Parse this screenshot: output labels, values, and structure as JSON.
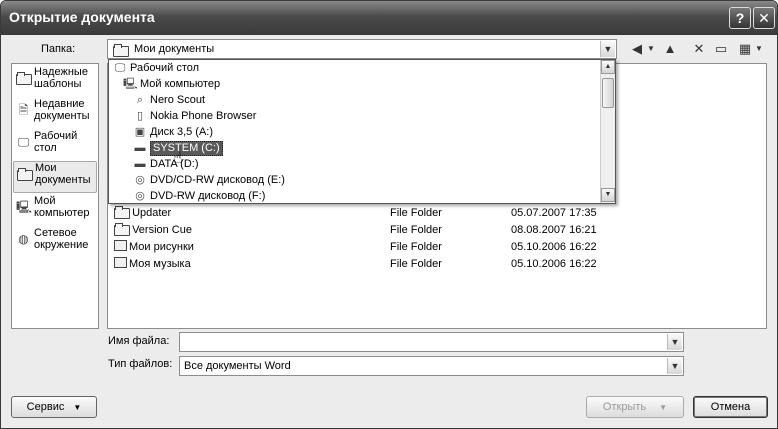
{
  "window": {
    "title": "Открытие документа"
  },
  "titlebar": {
    "help": "?",
    "close": "✕"
  },
  "look_in": {
    "label": "Папка:",
    "value": "Мои документы"
  },
  "toolbar": {
    "back": "◀",
    "up": "▲",
    "delete": "✕",
    "new_folder": "▭",
    "views": "▦"
  },
  "places": [
    {
      "label": "Надежные шаблоны",
      "icon": "folder-icon"
    },
    {
      "label": "Недавние документы",
      "icon": "recent-documents-icon"
    },
    {
      "label": "Рабочий стол",
      "icon": "desktop-icon"
    },
    {
      "label": "Мои документы",
      "icon": "my-documents-icon",
      "selected": true
    },
    {
      "label": "Мой компьютер",
      "icon": "computer-icon"
    },
    {
      "label": "Сетевое окружение",
      "icon": "network-icon"
    }
  ],
  "dropdown_items": [
    {
      "label": "Рабочий стол",
      "icon": "desktop-icon"
    },
    {
      "label": "Мой компьютер",
      "icon": "computer-icon"
    },
    {
      "label": "Nero Scout",
      "icon": "search-icon"
    },
    {
      "label": "Nokia Phone Browser",
      "icon": "phone-icon"
    },
    {
      "label": "Диск 3,5 (A:)",
      "icon": "floppy-icon"
    },
    {
      "label": "SYSTEM (C:)",
      "icon": "hard-drive-icon",
      "selected": true
    },
    {
      "label": "DATA (D:)",
      "icon": "hard-drive-icon"
    },
    {
      "label": "DVD/CD-RW дисковод (E:)",
      "icon": "optical-drive-icon"
    },
    {
      "label": "DVD-RW дисковод (F:)",
      "icon": "optical-drive-icon"
    }
  ],
  "files": [
    {
      "name": "Updater",
      "type": "File Folder",
      "date": "05.07.2007 17:35",
      "icon": "folder-icon"
    },
    {
      "name": "Version Cue",
      "type": "File Folder",
      "date": "08.08.2007 16:21",
      "icon": "folder-icon"
    },
    {
      "name": "Мои рисунки",
      "type": "File Folder",
      "date": "05.10.2006 16:22",
      "icon": "pictures-folder-icon"
    },
    {
      "name": "Моя музыка",
      "type": "File Folder",
      "date": "05.10.2006 16:22",
      "icon": "music-folder-icon"
    }
  ],
  "filename": {
    "label": "Имя файла:",
    "value": ""
  },
  "filetype": {
    "label": "Тип файлов:",
    "value": "Все документы Word"
  },
  "buttons": {
    "service": "Сервис",
    "open": "Открыть",
    "cancel": "Отмена"
  },
  "glyphs": {
    "dropdown_arrow": "▼",
    "scroll_up": "▲",
    "scroll_down": "▼"
  }
}
